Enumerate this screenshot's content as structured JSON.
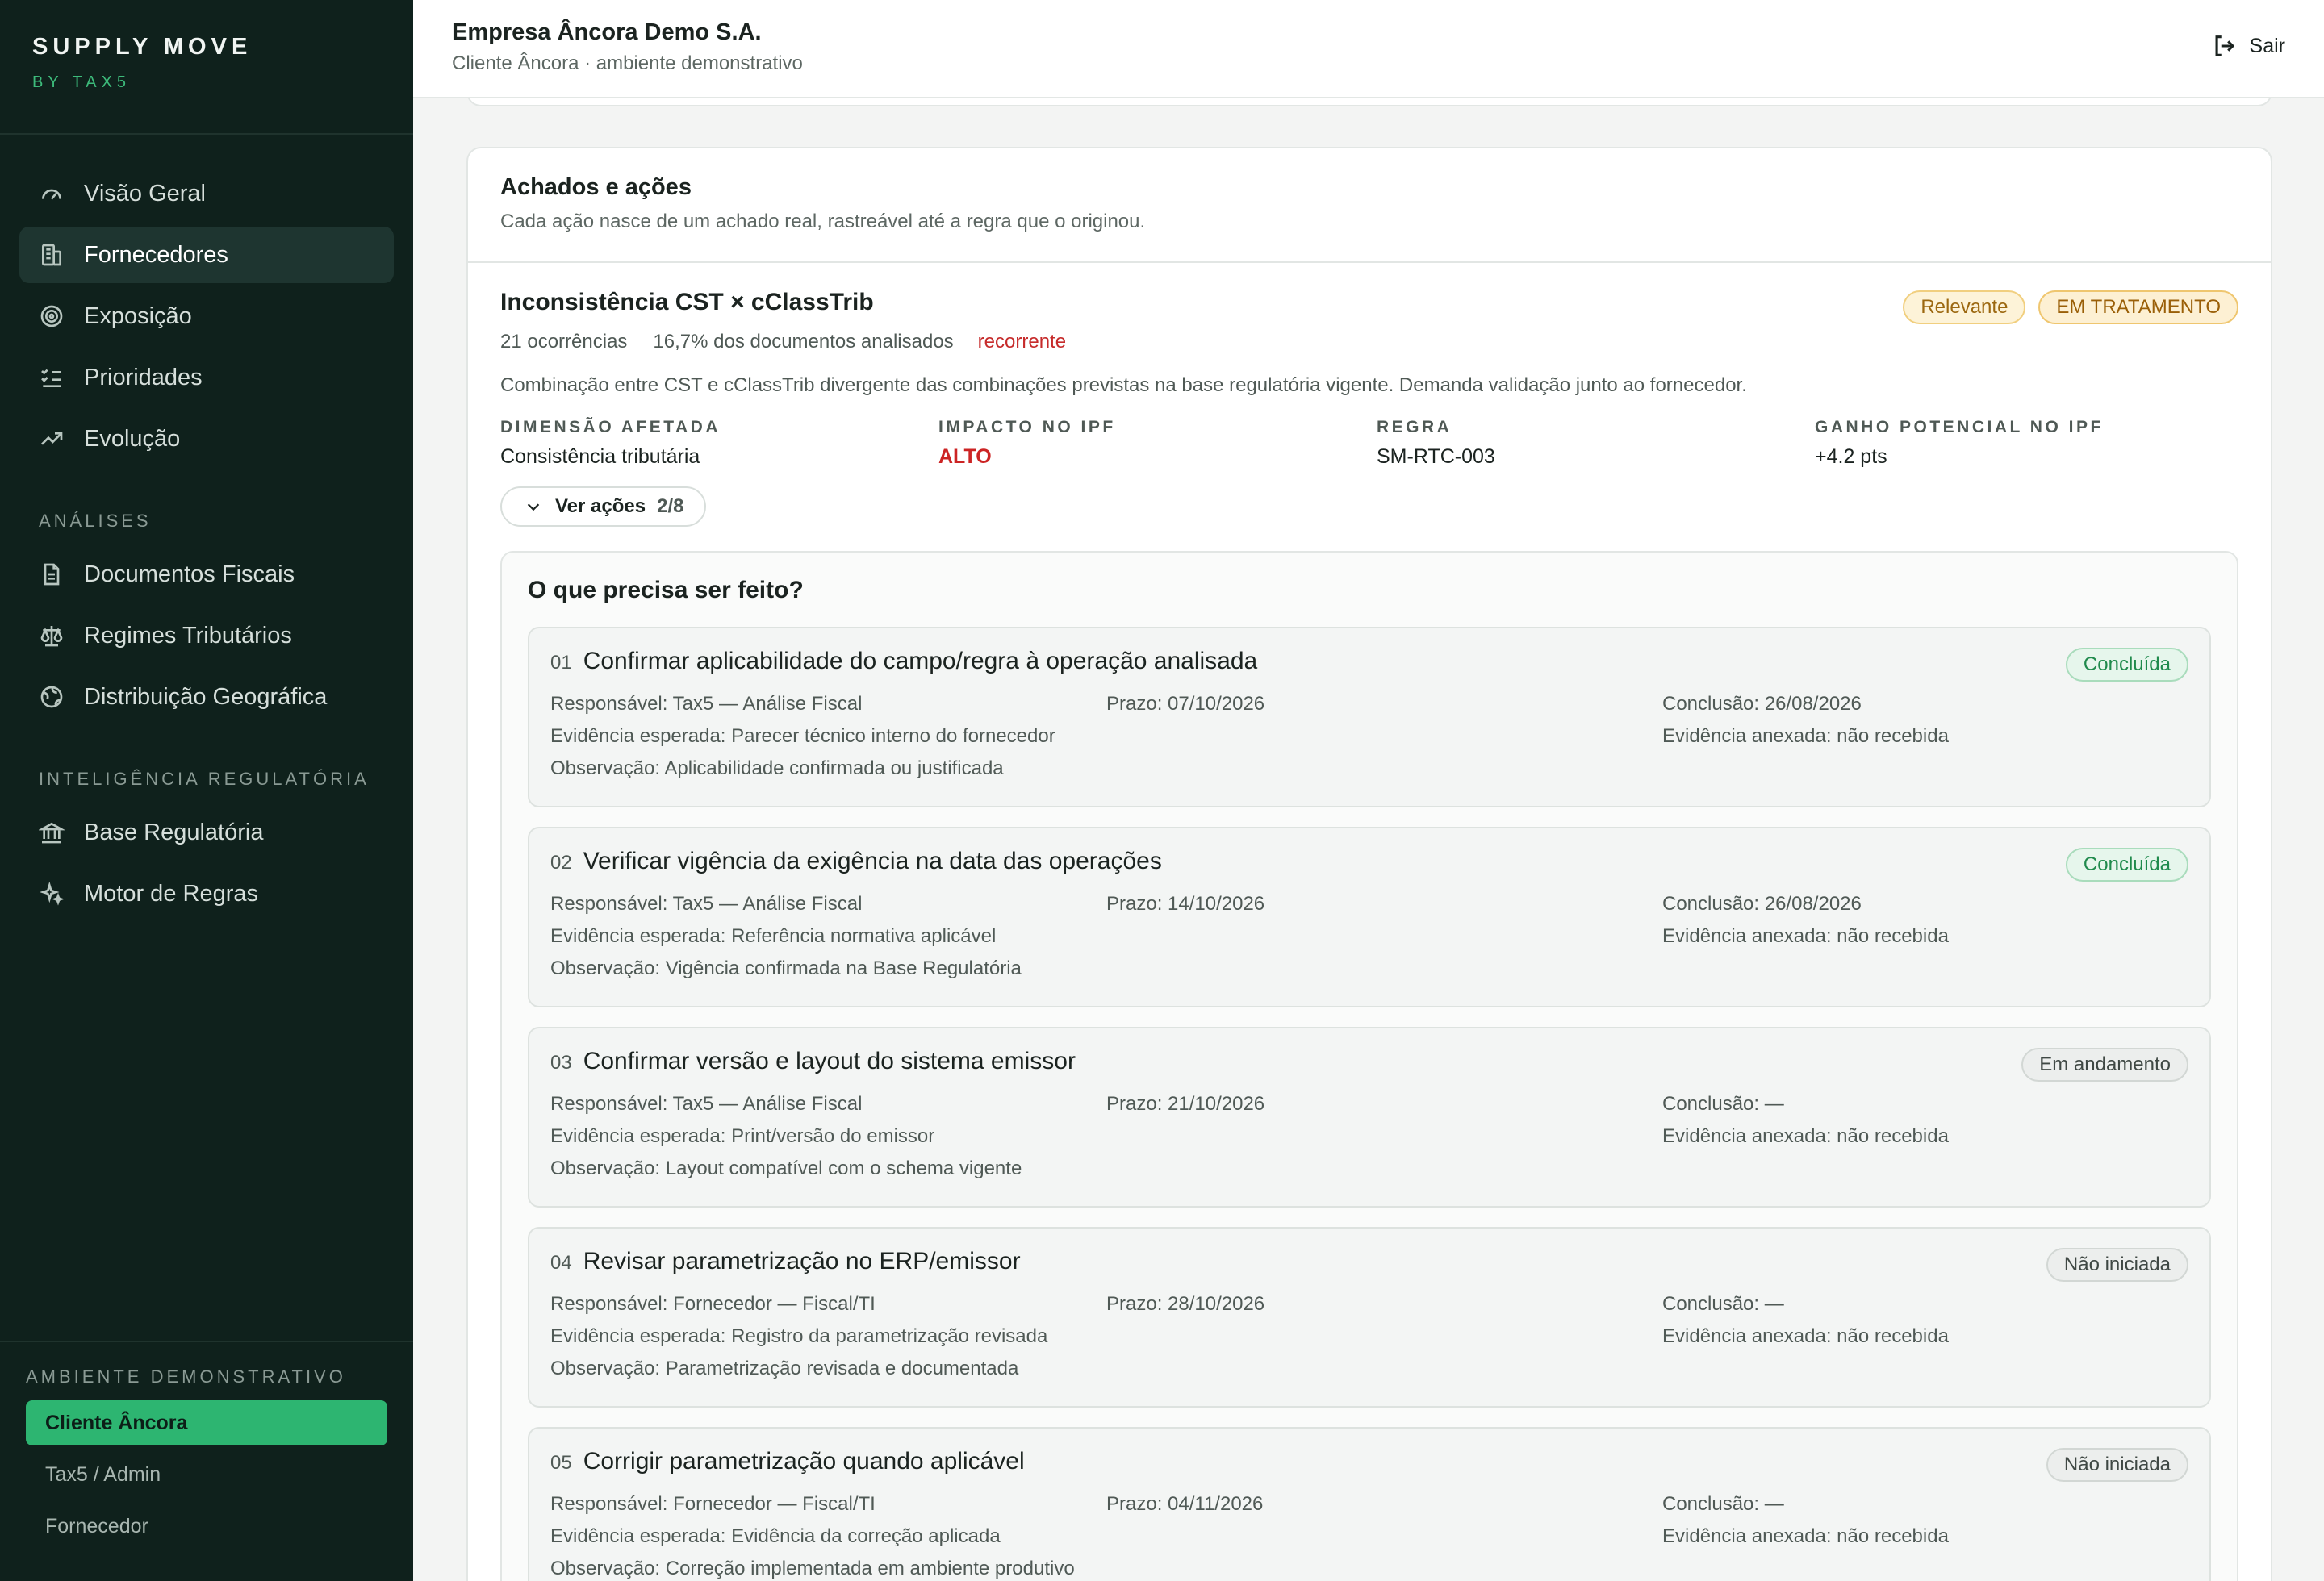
{
  "brand": {
    "title": "SUPPLY MOVE",
    "subtitle": "BY TAX5"
  },
  "sidebar": {
    "items": [
      {
        "label": "Visão Geral",
        "icon": "gauge-icon"
      },
      {
        "label": "Fornecedores",
        "icon": "building-icon",
        "active": true
      },
      {
        "label": "Exposição",
        "icon": "target-icon"
      },
      {
        "label": "Prioridades",
        "icon": "list-checks-icon"
      },
      {
        "label": "Evolução",
        "icon": "trending-up-icon"
      }
    ],
    "section_analises": "ANÁLISES",
    "analises": [
      {
        "label": "Documentos Fiscais",
        "icon": "document-icon"
      },
      {
        "label": "Regimes Tributários",
        "icon": "scale-icon"
      },
      {
        "label": "Distribuição Geográfica",
        "icon": "globe-icon"
      }
    ],
    "section_inteligencia": "INTELIGÊNCIA REGULATÓRIA",
    "inteligencia": [
      {
        "label": "Base Regulatória",
        "icon": "landmark-icon"
      },
      {
        "label": "Motor de Regras",
        "icon": "sparkles-icon"
      }
    ],
    "env_title": "AMBIENTE DEMONSTRATIVO",
    "env_items": [
      {
        "label": "Cliente Âncora",
        "active": true
      },
      {
        "label": "Tax5 / Admin"
      },
      {
        "label": "Fornecedor"
      }
    ]
  },
  "header": {
    "company": "Empresa Âncora Demo S.A.",
    "subtitle": "Cliente Âncora · ambiente demonstrativo",
    "logout": "Sair"
  },
  "card": {
    "title": "Achados e ações",
    "subtitle": "Cada ação nasce de um achado real, rastreável até a regra que o originou."
  },
  "finding": {
    "title": "Inconsistência CST × cClassTrib",
    "badge_relevance": "Relevante",
    "badge_status": "EM TRATAMENTO",
    "occurrences": "21 ocorrências",
    "share": "16,7% dos documentos analisados",
    "recurrence": "recorrente",
    "description": "Combinação entre CST e cClassTrib divergente das combinações previstas na base regulatória vigente. Demanda validação junto ao fornecedor.",
    "dims": [
      {
        "label": "DIMENSÃO AFETADA",
        "value": "Consistência tributária"
      },
      {
        "label": "IMPACTO NO IPF",
        "value": "ALTO"
      },
      {
        "label": "REGRA",
        "value": "SM-RTC-003"
      },
      {
        "label": "GANHO POTENCIAL NO IPF",
        "value": "+4.2 pts"
      }
    ],
    "ver_acoes": "Ver ações",
    "ver_acoes_count": "2/8"
  },
  "todo": {
    "title": "O que precisa ser feito?",
    "actions": [
      {
        "num": "01",
        "title": "Confirmar aplicabilidade do campo/regra à operação analisada",
        "status": "Concluída",
        "responsavel": "Responsável: Tax5 — Análise Fiscal",
        "prazo": "Prazo: 07/10/2026",
        "conclusao": "Conclusão: 26/08/2026",
        "evidencia": "Evidência esperada: Parecer técnico interno do fornecedor",
        "anexada": "Evidência anexada: não recebida",
        "observacao": "Observação: Aplicabilidade confirmada ou justificada"
      },
      {
        "num": "02",
        "title": "Verificar vigência da exigência na data das operações",
        "status": "Concluída",
        "responsavel": "Responsável: Tax5 — Análise Fiscal",
        "prazo": "Prazo: 14/10/2026",
        "conclusao": "Conclusão: 26/08/2026",
        "evidencia": "Evidência esperada: Referência normativa aplicável",
        "anexada": "Evidência anexada: não recebida",
        "observacao": "Observação: Vigência confirmada na Base Regulatória"
      },
      {
        "num": "03",
        "title": "Confirmar versão e layout do sistema emissor",
        "status": "Em andamento",
        "responsavel": "Responsável: Tax5 — Análise Fiscal",
        "prazo": "Prazo: 21/10/2026",
        "conclusao": "Conclusão: —",
        "evidencia": "Evidência esperada: Print/versão do emissor",
        "anexada": "Evidência anexada: não recebida",
        "observacao": "Observação: Layout compatível com o schema vigente"
      },
      {
        "num": "04",
        "title": "Revisar parametrização no ERP/emissor",
        "status": "Não iniciada",
        "responsavel": "Responsável: Fornecedor — Fiscal/TI",
        "prazo": "Prazo: 28/10/2026",
        "conclusao": "Conclusão: —",
        "evidencia": "Evidência esperada: Registro da parametrização revisada",
        "anexada": "Evidência anexada: não recebida",
        "observacao": "Observação: Parametrização revisada e documentada"
      },
      {
        "num": "05",
        "title": "Corrigir parametrização quando aplicável",
        "status": "Não iniciada",
        "responsavel": "Responsável: Fornecedor — Fiscal/TI",
        "prazo": "Prazo: 04/11/2026",
        "conclusao": "Conclusão: —",
        "evidencia": "Evidência esperada: Evidência da correção aplicada",
        "anexada": "Evidência anexada: não recebida",
        "observacao": "Observação: Correção implementada em ambiente produtivo"
      }
    ]
  }
}
